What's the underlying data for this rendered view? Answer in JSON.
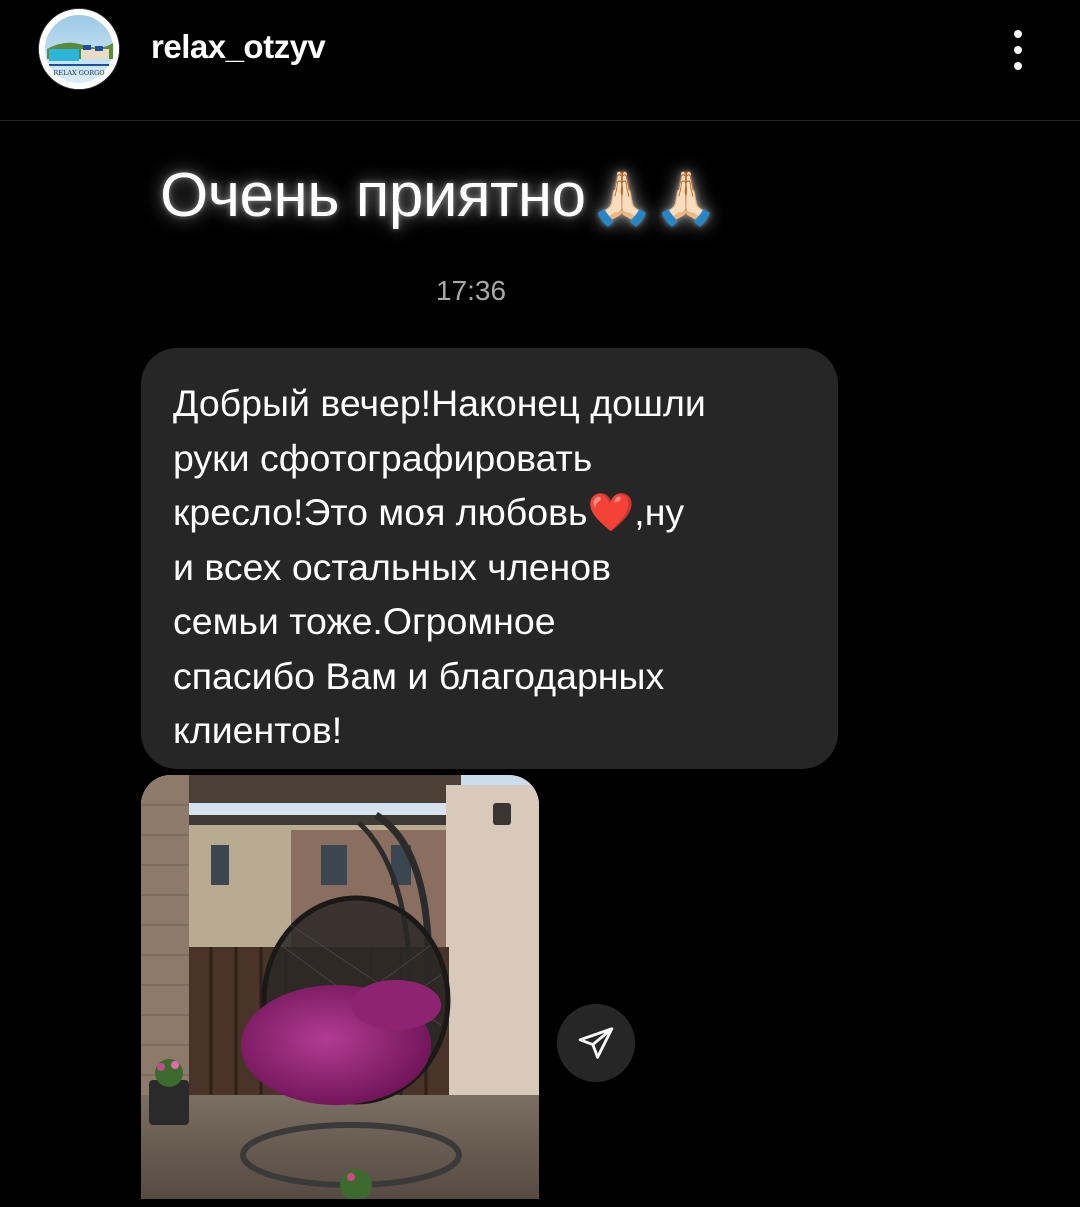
{
  "header": {
    "username": "relax_otzyv",
    "avatar_caption": "RELAX GORGO",
    "more_icon": "more-vertical-icon"
  },
  "story": {
    "reply_text": "Очень приятно",
    "reply_emoji": "🙏🏻🙏🏻",
    "timestamp": "17:36",
    "message_text": "Добрый вечер!Наконец дошли\nруки сфотографировать\nкресло!Это моя любовь❤️,ну\nи всех остальных членов\nсемьи тоже.Огромное\nспасибо Вам и благодарных\nклиентов!",
    "photo_icon": "photo-hanging-chair",
    "share_icon": "paper-plane-icon"
  },
  "colors": {
    "background": "#000000",
    "bubble": "#262626",
    "timestamp": "#a8a8a8",
    "text": "#ffffff"
  }
}
